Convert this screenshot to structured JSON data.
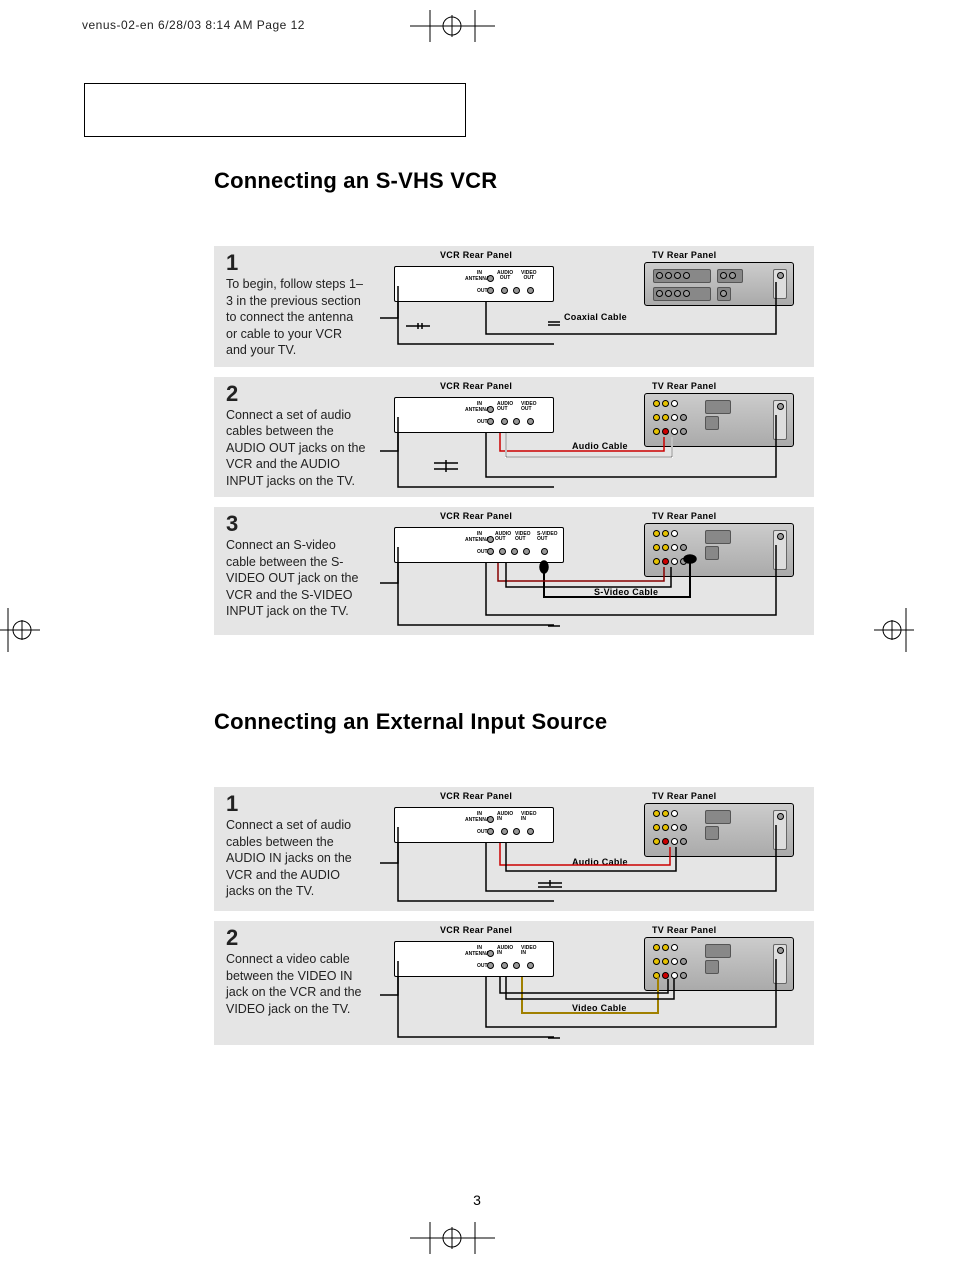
{
  "header_slug": "venus-02-en  6/28/03 8:14 AM  Page 12",
  "section1_title": "Connecting an S-VHS VCR",
  "section2_title": "Connecting an External Input Source",
  "page_number": "3",
  "labels": {
    "vcr_panel": "VCR Rear Panel",
    "tv_panel": "TV Rear Panel",
    "coax_cable": "Coaxial Cable",
    "audio_cable": "Audio Cable",
    "svideo_cable": "S-Video Cable",
    "video_cable": "Video Cable",
    "in": "IN",
    "out": "OUT",
    "antenna": "ANTENNA",
    "audio_out": "AUDIO\nOUT",
    "video_out": "VIDEO\nOUT",
    "svideo_out": "S-VIDEO\nOUT",
    "audio_in": "AUDIO\nIN",
    "video_in": "VIDEO\nIN"
  },
  "s1": {
    "step1": {
      "num": "1",
      "text": "To begin, follow steps 1–3 in the previous section to connect the antenna or cable to your VCR and your TV."
    },
    "step2": {
      "num": "2",
      "text": "Connect a set of audio cables between the AUDIO OUT jacks on the  VCR and the AUDIO INPUT jacks on the TV."
    },
    "step3": {
      "num": "3",
      "text": "Connect an S-video cable between the S-VIDEO OUT jack on the VCR and the S-VIDEO INPUT jack on the TV."
    }
  },
  "s2": {
    "step1": {
      "num": "1",
      "text": "Connect a set of audio cables between the AUDIO IN jacks on the VCR and the AUDIO jacks on the TV."
    },
    "step2": {
      "num": "2",
      "text": "Connect a video cable between the VIDEO IN jack on the VCR and the VIDEO jack on the TV."
    }
  }
}
